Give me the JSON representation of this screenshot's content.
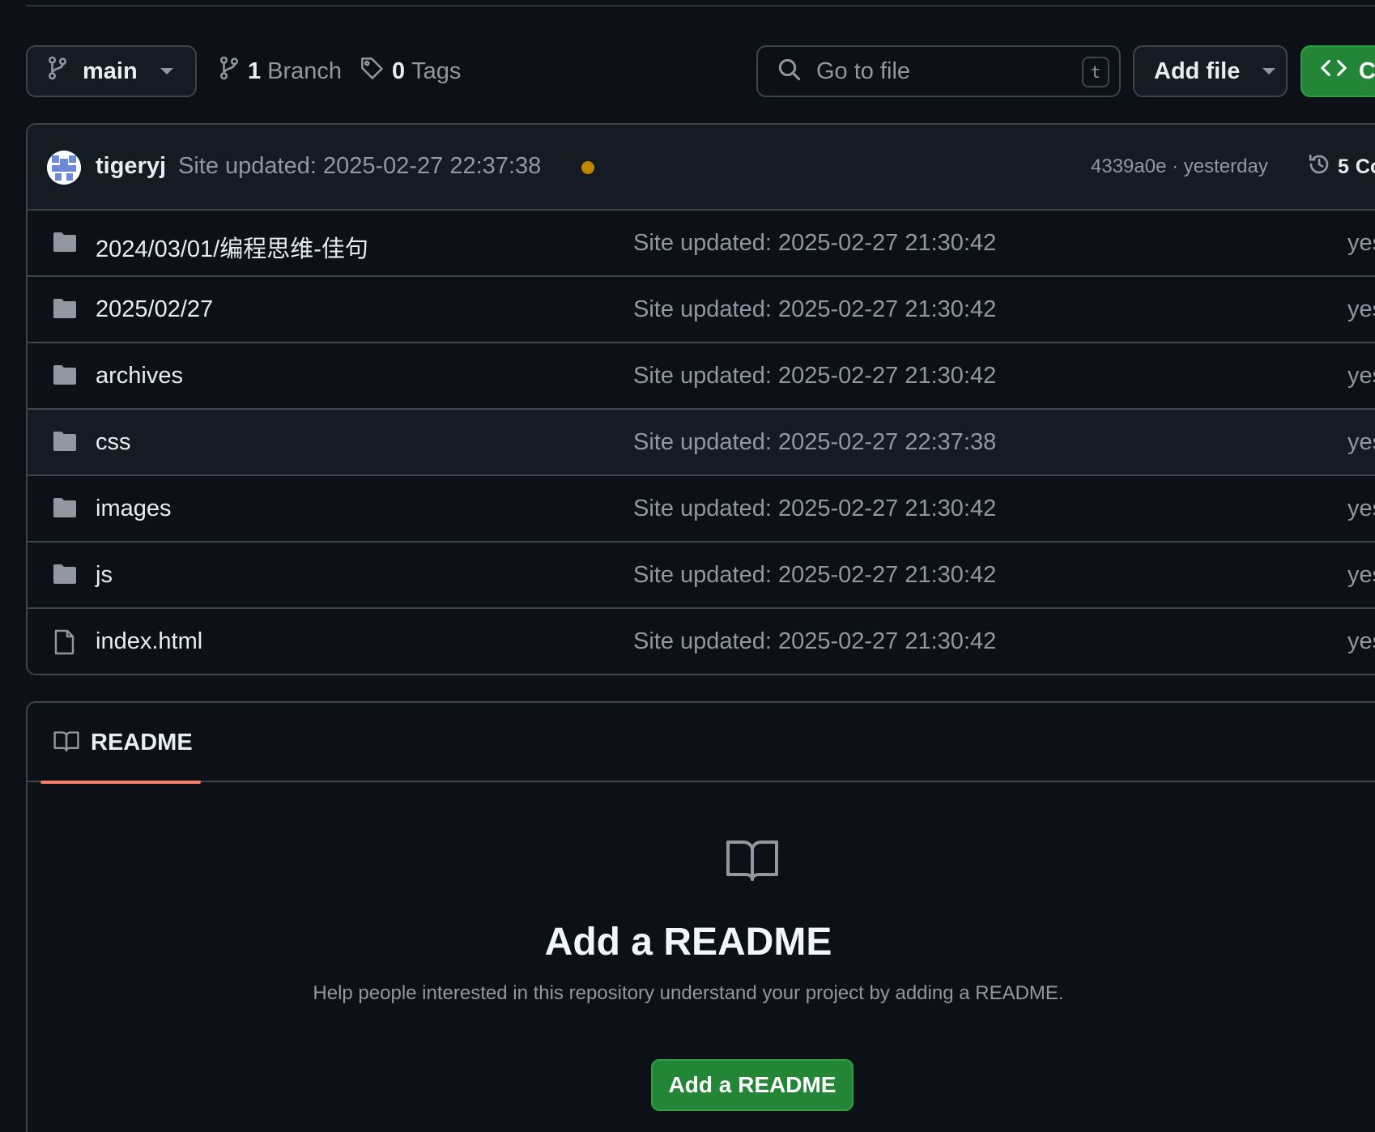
{
  "toolbar": {
    "branch_name": "main",
    "branches_count": "1",
    "branches_label": "Branch",
    "tags_count": "0",
    "tags_label": "Tags",
    "goto_placeholder": "Go to file",
    "goto_shortcut": "t",
    "add_file_label": "Add file",
    "code_label": "Code"
  },
  "latest_commit": {
    "author": "tigeryj",
    "message": "Site updated: 2025-02-27 22:37:38",
    "status_color": "#bf8700",
    "hash": "4339a0e",
    "separator": "·",
    "time": "yesterday",
    "commits_count": "5",
    "commits_label": "Commits"
  },
  "files": [
    {
      "type": "folder",
      "name": "2024/03/01/编程思维-佳句",
      "message": "Site updated: 2025-02-27 21:30:42",
      "date": "yesterday"
    },
    {
      "type": "folder",
      "name": "2025/02/27",
      "message": "Site updated: 2025-02-27 21:30:42",
      "date": "yesterday"
    },
    {
      "type": "folder",
      "name": "archives",
      "message": "Site updated: 2025-02-27 21:30:42",
      "date": "yesterday"
    },
    {
      "type": "folder",
      "name": "css",
      "message": "Site updated: 2025-02-27 22:37:38",
      "date": "yesterday"
    },
    {
      "type": "folder",
      "name": "images",
      "message": "Site updated: 2025-02-27 21:30:42",
      "date": "yesterday"
    },
    {
      "type": "folder",
      "name": "js",
      "message": "Site updated: 2025-02-27 21:30:42",
      "date": "yesterday"
    },
    {
      "type": "file",
      "name": "index.html",
      "message": "Site updated: 2025-02-27 21:30:42",
      "date": "yesterday"
    }
  ],
  "readme": {
    "tab_label": "README",
    "empty_title": "Add a README",
    "empty_description": "Help people interested in this repository understand your project by adding a README.",
    "button_label": "Add a README"
  },
  "colors": {
    "background": "#0d1117",
    "border": "#3d444d",
    "accent_green": "#238636",
    "tab_underline": "#f78166",
    "muted_text": "#9198a1"
  },
  "icons": {
    "branch": "git-branch-icon",
    "tag": "tag-icon",
    "search": "search-icon",
    "code": "code-icon",
    "history": "history-icon",
    "folder": "folder-icon",
    "file": "file-icon",
    "book": "book-icon"
  }
}
